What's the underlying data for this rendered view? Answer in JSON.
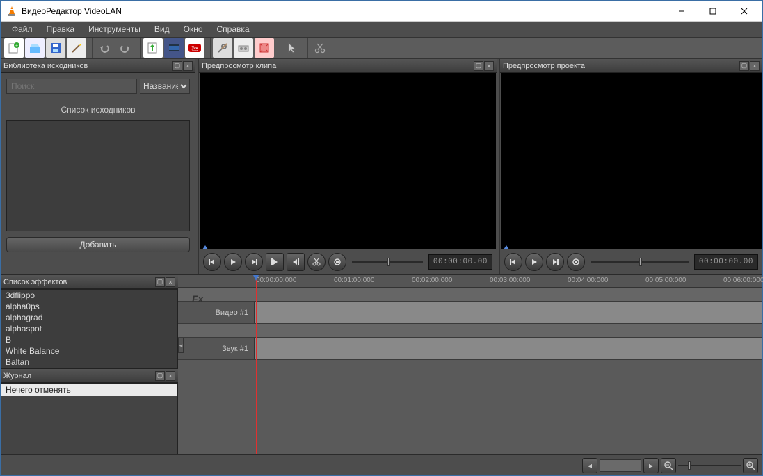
{
  "title": "ВидеоРедактор VideoLAN",
  "menu": [
    "Файл",
    "Правка",
    "Инструменты",
    "Вид",
    "Окно",
    "Справка"
  ],
  "toolbar_icons": [
    "new-project-icon",
    "open-icon",
    "save-icon",
    "wizard-icon",
    "undo-icon",
    "redo-icon",
    "import-icon",
    "clip-icon",
    "youtube-icon",
    "tools-icon",
    "render-icon",
    "fullscreen-icon",
    "cursor-icon",
    "cut-icon"
  ],
  "panels": {
    "library": {
      "title": "Библиотека исходников",
      "search_placeholder": "Поиск",
      "search_value": "",
      "sort_label": "Название",
      "list_heading": "Список исходников",
      "add_button": "Добавить"
    },
    "clip_preview": {
      "title": "Предпросмотр клипа",
      "timecode": "00:00:00.00"
    },
    "project_preview": {
      "title": "Предпросмотр проекта",
      "timecode": "00:00:00.00"
    },
    "effects": {
      "title": "Список эффектов",
      "items": [
        "3dflippo",
        "alpha0ps",
        "alphagrad",
        "alphaspot",
        "B",
        "White Balance",
        "Baltan"
      ]
    },
    "journal": {
      "title": "Журнал",
      "items": [
        "Нечего отменять"
      ]
    }
  },
  "timeline": {
    "ruler": [
      "00:00:00:000",
      "00:01:00:000",
      "00:02:00:000",
      "00:03:00:000",
      "00:04:00:000",
      "00:05:00:000",
      "00:06:00:000"
    ],
    "tracks": [
      {
        "label": "Видео #1"
      },
      {
        "label": "Звук #1"
      }
    ],
    "fx_label": "Fx"
  },
  "colors": {
    "bg": "#4d4d4d",
    "panel": "#3d3d3d",
    "accent": "#4477cc"
  }
}
